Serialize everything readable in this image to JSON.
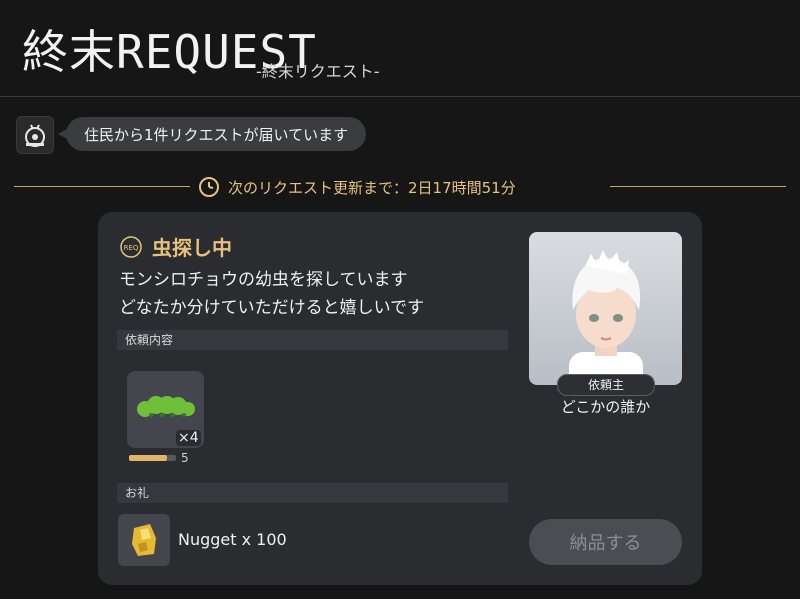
{
  "header": {
    "title": "終末REQUEST",
    "subtitle": "-終末リクエスト-"
  },
  "notification": {
    "icon": "mail-robot-icon",
    "message": "住民から1件リクエストが届いています"
  },
  "timer": {
    "icon": "clock-icon",
    "text": "次のリクエスト更新まで：2日17時間51分"
  },
  "request": {
    "badge_icon": "req-badge-icon",
    "status": "虫探し中",
    "description_line1": "モンシロチョウの幼虫を探しています",
    "description_line2": "どなたか分けていただけると嬉しいです",
    "contents_label": "依頼内容",
    "item": {
      "icon": "caterpillar-icon",
      "quantity": "×4",
      "target": "5",
      "progress_fraction": 0.8
    },
    "reward_label": "お礼",
    "reward": {
      "icon": "gold-nugget-icon",
      "text": "Nugget x 100"
    }
  },
  "client": {
    "tag": "依頼主",
    "name": "どこかの誰か"
  },
  "deliver_button": "納品する",
  "colors": {
    "accent": "#e7c27d",
    "card_bg": "#2a2c30",
    "page_bg": "#161616"
  }
}
